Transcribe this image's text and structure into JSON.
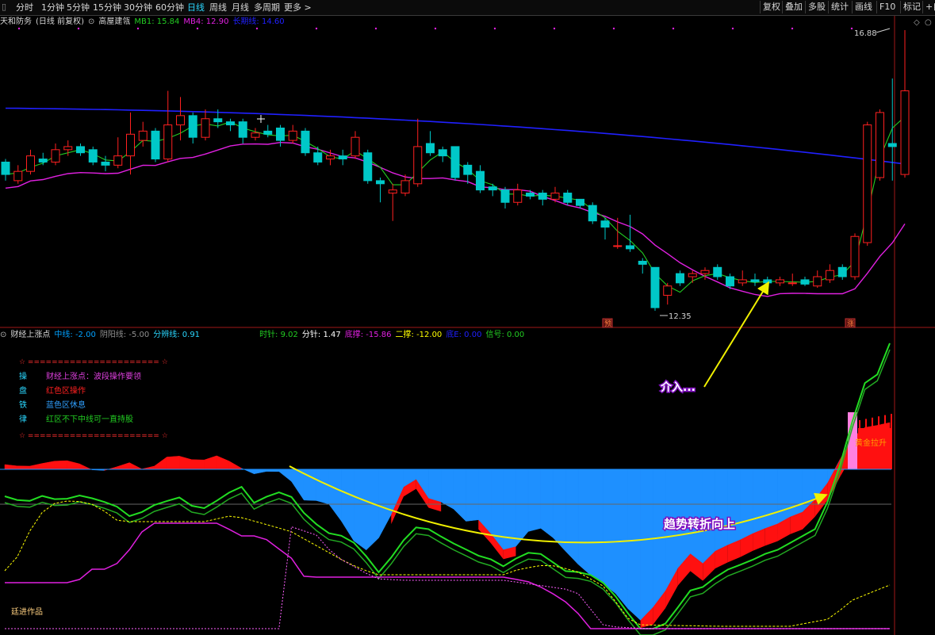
{
  "toolbar": {
    "tabs": [
      "分时",
      "1分钟",
      "5分钟",
      "15分钟",
      "30分钟",
      "60分钟",
      "日线",
      "周线",
      "月线",
      "多周期",
      "更多 >"
    ],
    "active_tab": "日线",
    "right_buttons": [
      "复权",
      "叠加",
      "多股",
      "统计",
      "画线",
      "F10",
      "标记",
      "+自"
    ]
  },
  "main_panel": {
    "stock_name": "天和防务",
    "period_info": "(日线 前复权)",
    "indicator_name": "高屋建瓴",
    "legend": [
      {
        "label": "MB1: 15.84",
        "color": "#22cc22"
      },
      {
        "label": "MB4: 12.90",
        "color": "#e020e0"
      },
      {
        "label": "长期线: 14.60",
        "color": "#2020ff"
      }
    ],
    "high_label": "16.88",
    "low_label": "12.35",
    "marker_bottom_1": "预",
    "marker_bottom_2": "涨"
  },
  "sub_panel": {
    "indicator_name": "财经上涨点",
    "legend": [
      {
        "label": "中线: -2.00",
        "color": "#00a0ff"
      },
      {
        "label": "阴阳线: -5.00",
        "color": "#909090"
      },
      {
        "label": "分辨线: 0.91",
        "color": "#2ad7ff"
      },
      {
        "label": "时针: 9.02",
        "color": "#22cc22"
      },
      {
        "label": "分针: 1.47",
        "color": "#ffffff"
      },
      {
        "label": "底撑: -15.86",
        "color": "#e020e0"
      },
      {
        "label": "二撑: -12.00",
        "color": "#ffff00"
      },
      {
        "label": "底E: 0.00",
        "color": "#2020ff"
      },
      {
        "label": "信号: 0.00",
        "color": "#22cc22"
      }
    ],
    "notes": {
      "separator": "☆ ====================== ☆",
      "rows": [
        {
          "key": "操",
          "text": "财经上涨点：波段操作要领",
          "color": "#e040e0"
        },
        {
          "key": "盘",
          "text": "红色区操作",
          "color": "#ff2020"
        },
        {
          "key": "铁",
          "text": "蓝色区休息",
          "color": "#30a0ff"
        },
        {
          "key": "律",
          "text": "红区不下中线可一直持股",
          "color": "#22cc22"
        }
      ]
    },
    "label_gold": "黄金拉升",
    "watermark": "廷进作品"
  },
  "annotations": {
    "entry": "介入...",
    "trend": "趋势转折向上"
  },
  "colors": {
    "up": "#ff2020",
    "down": "#00c8c8",
    "ma_green": "#22cc22",
    "ma_magenta": "#e020e0",
    "ma_blue": "#2020ff",
    "blue_fill": "#1e90ff",
    "red_fill": "#ff1010",
    "arrow": "#f0f000"
  },
  "chart_data": [
    {
      "type": "candlestick",
      "title": "天和防务 (日线 前复权)",
      "series": [
        {
          "name": "MB1",
          "values": [
            15.84
          ]
        },
        {
          "name": "MB4",
          "values": [
            12.9
          ]
        },
        {
          "name": "长期线",
          "values": [
            14.6
          ]
        }
      ],
      "max_price": 16.88,
      "min_price": 12.35,
      "candles": [
        {
          "o": 14.75,
          "c": 14.55,
          "h": 14.8,
          "l": 14.45
        },
        {
          "o": 14.45,
          "c": 14.6,
          "h": 14.7,
          "l": 14.4
        },
        {
          "o": 14.6,
          "c": 14.85,
          "h": 14.95,
          "l": 14.55
        },
        {
          "o": 14.8,
          "c": 14.75,
          "h": 14.9,
          "l": 14.7
        },
        {
          "o": 14.75,
          "c": 14.95,
          "h": 15.05,
          "l": 14.7
        },
        {
          "o": 14.95,
          "c": 15.0,
          "h": 15.1,
          "l": 14.85
        },
        {
          "o": 15.0,
          "c": 14.9,
          "h": 15.05,
          "l": 14.85
        },
        {
          "o": 14.95,
          "c": 14.75,
          "h": 15.0,
          "l": 14.7
        },
        {
          "o": 14.75,
          "c": 14.7,
          "h": 14.85,
          "l": 14.6
        },
        {
          "o": 14.7,
          "c": 14.85,
          "h": 15.15,
          "l": 14.65
        },
        {
          "o": 14.85,
          "c": 15.2,
          "h": 15.55,
          "l": 14.55
        },
        {
          "o": 15.1,
          "c": 15.25,
          "h": 15.4,
          "l": 15.0
        },
        {
          "o": 15.25,
          "c": 14.8,
          "h": 15.3,
          "l": 14.75
        },
        {
          "o": 14.8,
          "c": 15.35,
          "h": 15.9,
          "l": 14.75
        },
        {
          "o": 15.35,
          "c": 15.5,
          "h": 15.8,
          "l": 15.1
        },
        {
          "o": 15.5,
          "c": 15.15,
          "h": 15.55,
          "l": 15.05
        },
        {
          "o": 15.15,
          "c": 15.45,
          "h": 15.6,
          "l": 15.1
        },
        {
          "o": 15.45,
          "c": 15.4,
          "h": 15.6,
          "l": 15.3
        },
        {
          "o": 15.4,
          "c": 15.35,
          "h": 15.45,
          "l": 15.25
        },
        {
          "o": 15.4,
          "c": 15.15,
          "h": 15.45,
          "l": 15.05
        },
        {
          "o": 15.15,
          "c": 15.22,
          "h": 15.3,
          "l": 15.1
        },
        {
          "o": 15.25,
          "c": 15.2,
          "h": 15.35,
          "l": 15.15
        },
        {
          "o": 15.3,
          "c": 15.1,
          "h": 15.35,
          "l": 15.0
        },
        {
          "o": 15.1,
          "c": 15.25,
          "h": 15.35,
          "l": 15.05
        },
        {
          "o": 15.25,
          "c": 14.9,
          "h": 15.3,
          "l": 14.85
        },
        {
          "o": 14.9,
          "c": 14.75,
          "h": 15.0,
          "l": 14.7
        },
        {
          "o": 14.8,
          "c": 14.85,
          "h": 14.95,
          "l": 14.7
        },
        {
          "o": 14.85,
          "c": 14.8,
          "h": 14.95,
          "l": 14.7
        },
        {
          "o": 14.85,
          "c": 15.15,
          "h": 15.25,
          "l": 14.8
        },
        {
          "o": 14.9,
          "c": 14.45,
          "h": 14.95,
          "l": 14.4
        },
        {
          "o": 14.45,
          "c": 14.4,
          "h": 14.5,
          "l": 14.1
        },
        {
          "o": 14.25,
          "c": 14.3,
          "h": 14.4,
          "l": 13.8
        },
        {
          "o": 14.25,
          "c": 14.45,
          "h": 14.55,
          "l": 14.2
        },
        {
          "o": 14.4,
          "c": 15.0,
          "h": 15.45,
          "l": 14.35
        },
        {
          "o": 15.05,
          "c": 14.9,
          "h": 15.25,
          "l": 14.85
        },
        {
          "o": 14.95,
          "c": 14.85,
          "h": 15.0,
          "l": 14.75
        },
        {
          "o": 15.0,
          "c": 14.5,
          "h": 15.0,
          "l": 14.45
        },
        {
          "o": 14.7,
          "c": 14.55,
          "h": 14.75,
          "l": 14.4
        },
        {
          "o": 14.6,
          "c": 14.3,
          "h": 14.7,
          "l": 14.25
        },
        {
          "o": 14.35,
          "c": 14.3,
          "h": 14.4,
          "l": 14.2
        },
        {
          "o": 14.3,
          "c": 14.1,
          "h": 14.35,
          "l": 14.0
        },
        {
          "o": 14.1,
          "c": 14.3,
          "h": 14.4,
          "l": 14.05
        },
        {
          "o": 14.25,
          "c": 14.2,
          "h": 14.3,
          "l": 14.15
        },
        {
          "o": 14.25,
          "c": 14.15,
          "h": 14.3,
          "l": 14.05
        },
        {
          "o": 14.15,
          "c": 14.25,
          "h": 14.35,
          "l": 14.1
        },
        {
          "o": 14.25,
          "c": 14.1,
          "h": 14.3,
          "l": 14.05
        },
        {
          "o": 14.15,
          "c": 14.05,
          "h": 14.15,
          "l": 14.0
        },
        {
          "o": 14.05,
          "c": 13.8,
          "h": 14.1,
          "l": 13.75
        },
        {
          "o": 13.8,
          "c": 13.7,
          "h": 13.85,
          "l": 13.5
        },
        {
          "o": 13.4,
          "c": 13.4,
          "h": 13.85,
          "l": 13.35
        },
        {
          "o": 13.4,
          "c": 13.35,
          "h": 13.9,
          "l": 13.3
        },
        {
          "o": 13.15,
          "c": 13.1,
          "h": 13.2,
          "l": 12.95
        },
        {
          "o": 13.05,
          "c": 12.4,
          "h": 13.05,
          "l": 12.35
        },
        {
          "o": 12.6,
          "c": 12.75,
          "h": 12.8,
          "l": 12.45
        },
        {
          "o": 12.95,
          "c": 12.8,
          "h": 13.0,
          "l": 12.75
        },
        {
          "o": 12.9,
          "c": 12.95,
          "h": 13.0,
          "l": 12.8
        },
        {
          "o": 12.95,
          "c": 13.0,
          "h": 13.05,
          "l": 12.85
        },
        {
          "o": 13.05,
          "c": 12.9,
          "h": 13.1,
          "l": 12.85
        },
        {
          "o": 12.9,
          "c": 12.75,
          "h": 12.95,
          "l": 12.7
        },
        {
          "o": 12.8,
          "c": 12.85,
          "h": 13.0,
          "l": 12.75
        },
        {
          "o": 12.85,
          "c": 12.82,
          "h": 12.95,
          "l": 12.75
        },
        {
          "o": 12.85,
          "c": 12.8,
          "h": 12.9,
          "l": 12.75
        },
        {
          "o": 12.8,
          "c": 12.85,
          "h": 12.9,
          "l": 12.75
        },
        {
          "o": 12.8,
          "c": 12.8,
          "h": 12.95,
          "l": 12.75
        },
        {
          "o": 12.85,
          "c": 12.78,
          "h": 12.9,
          "l": 12.75
        },
        {
          "o": 12.75,
          "c": 12.9,
          "h": 13.0,
          "l": 12.72
        },
        {
          "o": 12.85,
          "c": 13.0,
          "h": 13.1,
          "l": 12.8
        },
        {
          "o": 13.05,
          "c": 12.9,
          "h": 13.1,
          "l": 12.85
        },
        {
          "o": 12.9,
          "c": 13.55,
          "h": 13.6,
          "l": 12.85
        },
        {
          "o": 13.45,
          "c": 15.35,
          "h": 15.4,
          "l": 13.4
        },
        {
          "o": 14.5,
          "c": 15.55,
          "h": 15.6,
          "l": 14.45
        },
        {
          "o": 15.05,
          "c": 15.0,
          "h": 16.1,
          "l": 14.45
        },
        {
          "o": 14.55,
          "c": 15.9,
          "h": 16.88,
          "l": 14.5
        }
      ]
    },
    {
      "type": "area",
      "title": "财经上涨点",
      "series": [
        {
          "name": "中线",
          "values": [
            -2.0
          ]
        },
        {
          "name": "阴阳线",
          "values": [
            -5.0
          ]
        },
        {
          "name": "分辨线",
          "values": [
            0.91
          ]
        },
        {
          "name": "时针",
          "values": [
            9.02
          ]
        },
        {
          "name": "分针",
          "values": [
            1.47
          ]
        },
        {
          "name": "底撑",
          "values": [
            -15.86
          ]
        },
        {
          "name": "二撑",
          "values": [
            -12.0
          ]
        },
        {
          "name": "底E",
          "values": [
            0.0
          ]
        },
        {
          "name": "信号",
          "values": [
            0.0
          ]
        }
      ]
    }
  ]
}
